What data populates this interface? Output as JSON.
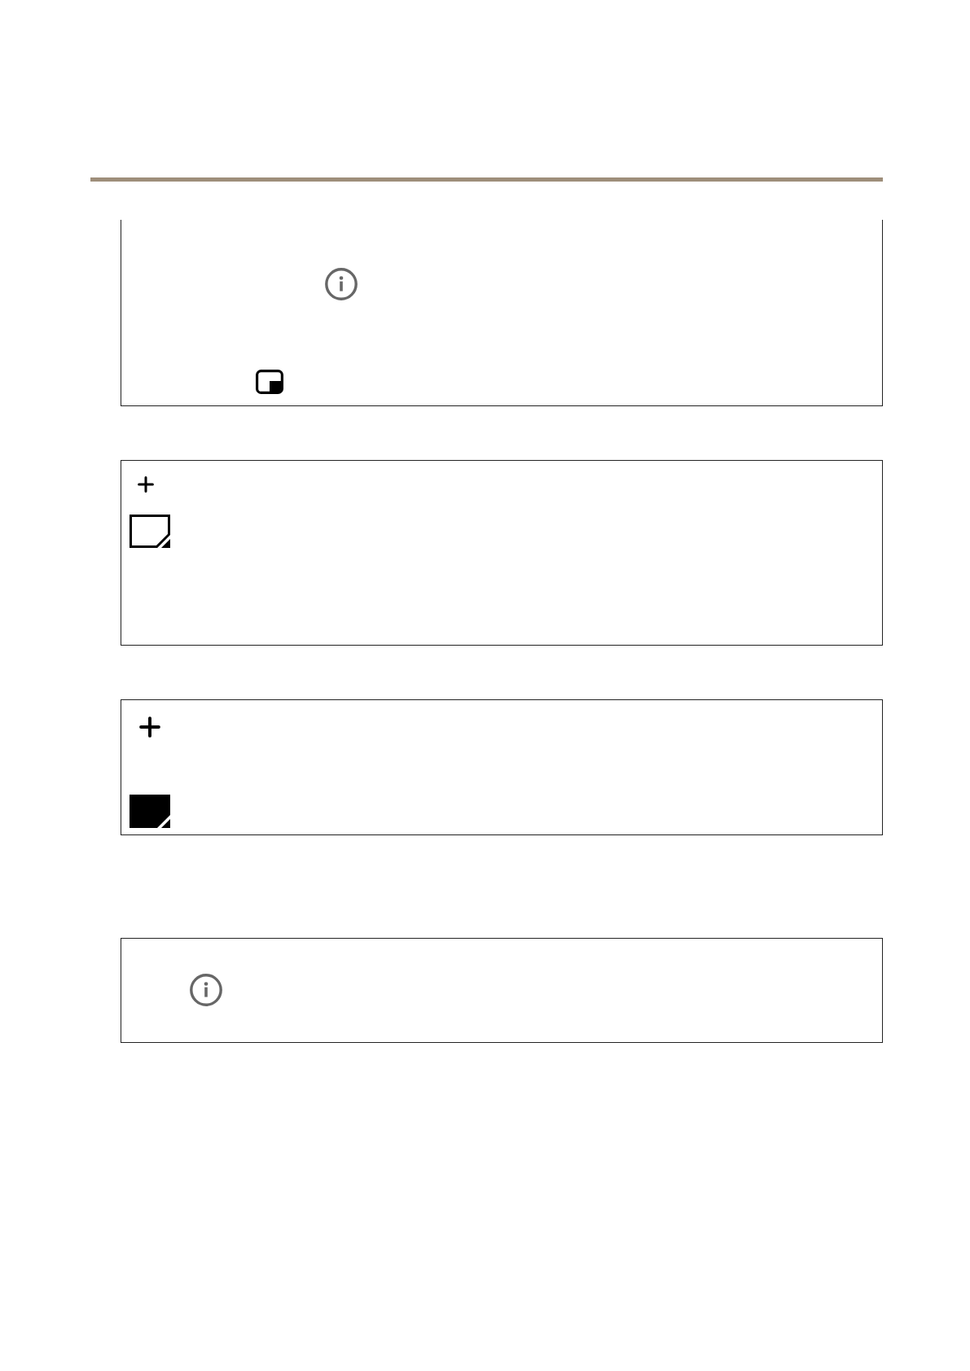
{
  "panels": [
    {
      "continued": true,
      "icons": [
        {
          "kind": "info"
        },
        {
          "kind": "picture-in-picture"
        }
      ]
    },
    {
      "continued": false,
      "icons": [
        {
          "kind": "add"
        },
        {
          "kind": "note",
          "filled": false
        }
      ]
    },
    {
      "continued": false,
      "icons": [
        {
          "kind": "add"
        },
        {
          "kind": "note",
          "filled": true
        }
      ]
    },
    {
      "continued": false,
      "icons": [
        {
          "kind": "info"
        }
      ]
    }
  ]
}
